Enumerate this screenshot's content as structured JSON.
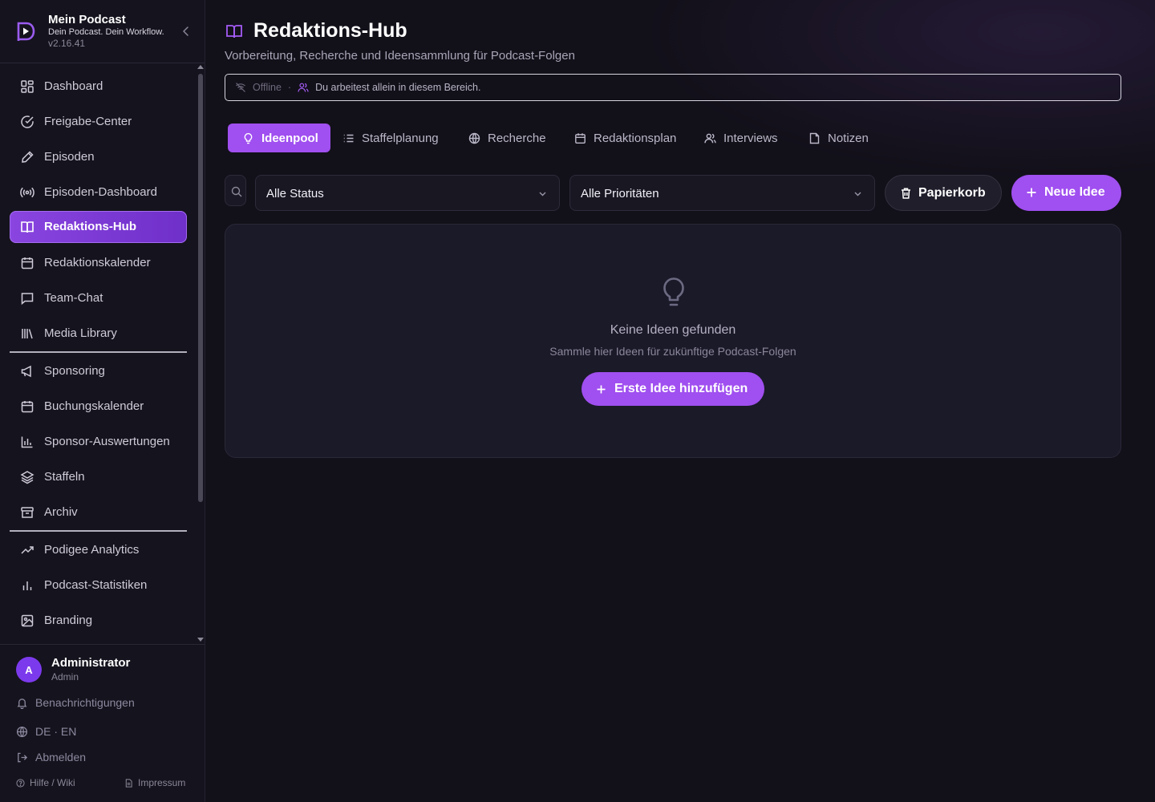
{
  "brand": {
    "title": "Mein Podcast",
    "tagline": "Dein Podcast. Dein Workflow.",
    "version": "v2.16.41"
  },
  "sidebar": {
    "items": [
      {
        "label": "Dashboard",
        "icon": "grid-icon"
      },
      {
        "label": "Freigabe-Center",
        "icon": "check-circle-icon"
      },
      {
        "label": "Episoden",
        "icon": "pen-icon"
      },
      {
        "label": "Episoden-Dashboard",
        "icon": "broadcast-icon"
      },
      {
        "label": "Redaktions-Hub",
        "icon": "book-icon",
        "active": true
      },
      {
        "label": "Redaktionskalender",
        "icon": "calendar-icon"
      },
      {
        "label": "Team-Chat",
        "icon": "chat-icon"
      },
      {
        "label": "Media Library",
        "icon": "library-icon"
      },
      {
        "label": "Sponsoring",
        "icon": "megaphone-icon"
      },
      {
        "label": "Buchungskalender",
        "icon": "calendar-icon"
      },
      {
        "label": "Sponsor-Auswertungen",
        "icon": "bar-chart-icon"
      },
      {
        "label": "Staffeln",
        "icon": "layers-icon"
      },
      {
        "label": "Archiv",
        "icon": "archive-icon"
      },
      {
        "label": "Podigee Analytics",
        "icon": "trending-up-icon"
      },
      {
        "label": "Podcast-Statistiken",
        "icon": "bar-chart-icon"
      },
      {
        "label": "Branding",
        "icon": "image-icon"
      }
    ]
  },
  "user": {
    "initial": "A",
    "name": "Administrator",
    "role": "Admin",
    "notifications_label": "Benachrichtigungen",
    "language_label": "DE · EN",
    "logout_label": "Abmelden",
    "help_label": "Hilfe / Wiki",
    "imprint_label": "Impressum"
  },
  "page": {
    "title": "Redaktions-Hub",
    "subtitle": "Vorbereitung, Recherche und Ideensammlung für Podcast-Folgen"
  },
  "presence": {
    "status": "Offline",
    "separator": "·",
    "message": "Du arbeitest allein in diesem Bereich."
  },
  "tabs": [
    {
      "label": "Ideenpool",
      "icon": "lightbulb-icon",
      "active": true
    },
    {
      "label": "Staffelplanung",
      "icon": "list-icon"
    },
    {
      "label": "Recherche",
      "icon": "globe-icon"
    },
    {
      "label": "Redaktionsplan",
      "icon": "calendar-icon"
    },
    {
      "label": "Interviews",
      "icon": "users-icon"
    },
    {
      "label": "Notizen",
      "icon": "note-icon"
    }
  ],
  "filters": {
    "status_value": "Alle Status",
    "priority_value": "Alle Prioritäten",
    "trash_label": "Papierkorb",
    "new_label": "Neue Idee"
  },
  "empty": {
    "title": "Keine Ideen gefunden",
    "subtitle": "Sammle hier Ideen für zukünftige Podcast-Folgen",
    "button_label": "Erste Idee hinzufügen"
  },
  "colors": {
    "accent": "#a04ff0",
    "background": "#121019",
    "sidebar": "#15131d",
    "card": "#1b1a29"
  }
}
